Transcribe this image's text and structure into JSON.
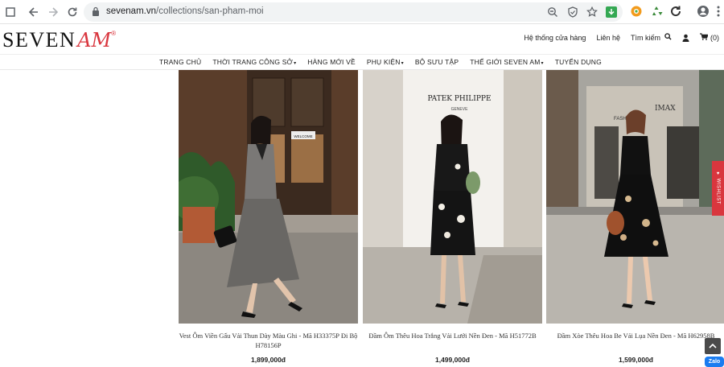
{
  "browser": {
    "url_domain": "sevenam.vn",
    "url_path": "/collections/san-pham-moi"
  },
  "site": {
    "logo_text": "SEVEN",
    "logo_accent": "AM",
    "logo_reg": "®",
    "header_links": [
      {
        "label": "Hệ thống cửa hàng"
      },
      {
        "label": "Liên hệ"
      },
      {
        "label": "Tìm kiếm"
      },
      {
        "label": "(0)"
      }
    ],
    "nav": [
      {
        "label": "TRANG CHỦ"
      },
      {
        "label": "THỜI TRANG CÔNG SỞ"
      },
      {
        "label": "HÀNG MỚI VỀ"
      },
      {
        "label": "PHỤ KIỆN"
      },
      {
        "label": "BỘ SƯU TẬP"
      },
      {
        "label": "THẾ GIỚI SEVEN AM"
      },
      {
        "label": "TUYỂN DỤNG"
      }
    ],
    "nav_caret": "▾",
    "wishlist_label": "♥ WISHLIST",
    "zalo_label": "Zalo",
    "accent_color": "#d9363e"
  },
  "products": [
    {
      "name": "Vest Ôm Viền Gấu Vải Thun Dày Màu Ghi - Mã H33375P Đi Bộ H78156P",
      "price": "1,899,000đ",
      "sign_text": "WELCOME"
    },
    {
      "name": "Đầm Ôm Thêu Hoa Trắng Vải Lưới Nền Đen - Mã H51772B",
      "price": "1,499,000đ",
      "sign_text": "PATEK PHILIPPE",
      "sign_sub": "GENEVE"
    },
    {
      "name": "Đầm Xòe Thêu Hoa Be Vải Lụa Nền Đen - Mã H62958B",
      "price": "1,599,000đ",
      "sign_text": "FASHION",
      "sign_sub": "IMAX"
    }
  ]
}
